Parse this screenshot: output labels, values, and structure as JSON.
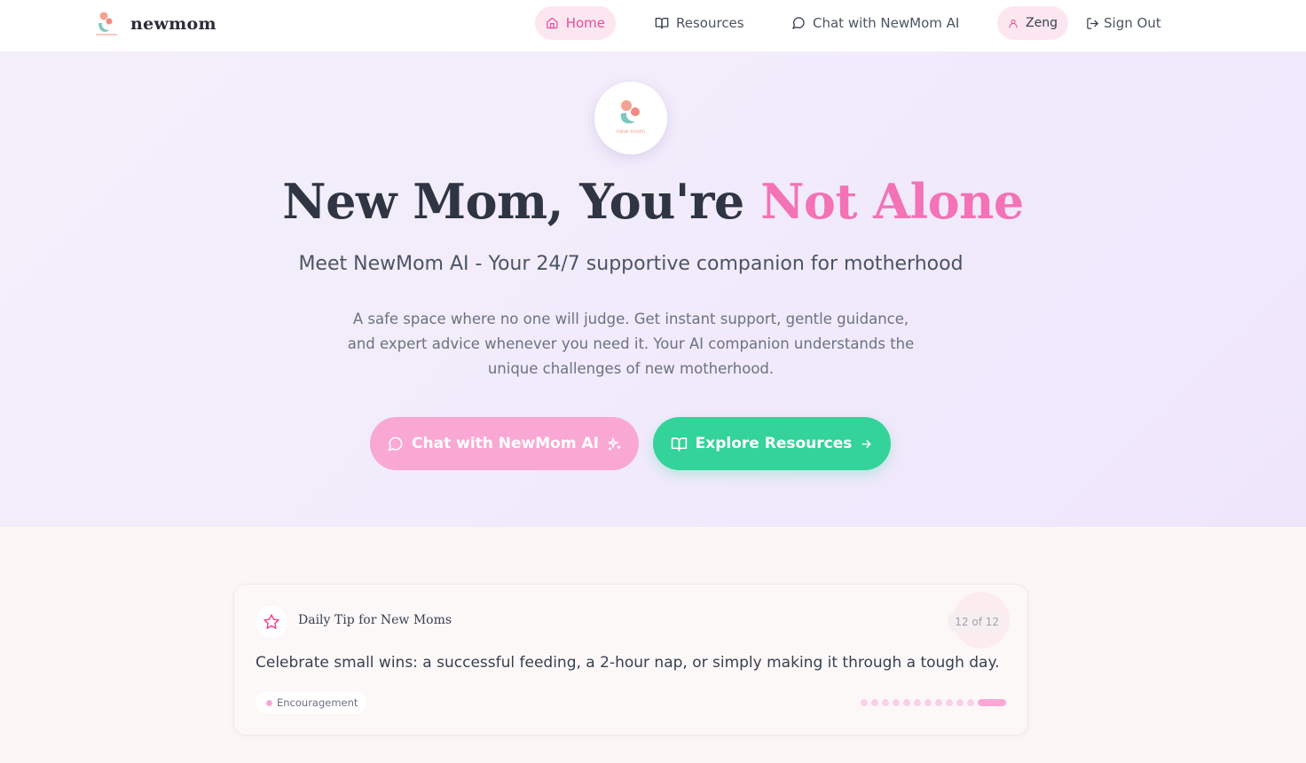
{
  "nav": {
    "brand": "newmom",
    "items": [
      {
        "label": "Home",
        "icon": "home-icon",
        "active": true
      },
      {
        "label": "Resources",
        "icon": "book-open-icon"
      },
      {
        "label": "Chat with NewMom AI",
        "icon": "message-circle-icon"
      }
    ],
    "user": {
      "name": "Zeng",
      "icon": "user-icon"
    },
    "signout": {
      "label": "Sign Out",
      "icon": "log-out-icon"
    }
  },
  "hero": {
    "badge_text": "new mom",
    "title_main": "New Mom, You're ",
    "title_accent": "Not Alone",
    "subtitle": "Meet NewMom AI - Your 24/7 supportive companion for motherhood",
    "description": "A safe space where no one will judge. Get instant support, gentle guidance, and expert advice whenever you need it. Your AI companion understands the unique challenges of new motherhood.",
    "primary_button": "Chat with NewMom AI",
    "secondary_button": "Explore Resources"
  },
  "tip": {
    "title": "Daily Tip for New Moms",
    "counter": "12 of 12",
    "text": "Celebrate small wins: a successful feeding, a 2-hour nap, or simply making it through a tough day.",
    "tag": "Encouragement",
    "total": 12,
    "current": 12
  },
  "colors": {
    "accent_pink": "#f472b6",
    "button_pink": "#f9a8d4",
    "button_green": "#34d399",
    "logo_teal": "#7cc8c0",
    "logo_coral": "#f4a293"
  }
}
